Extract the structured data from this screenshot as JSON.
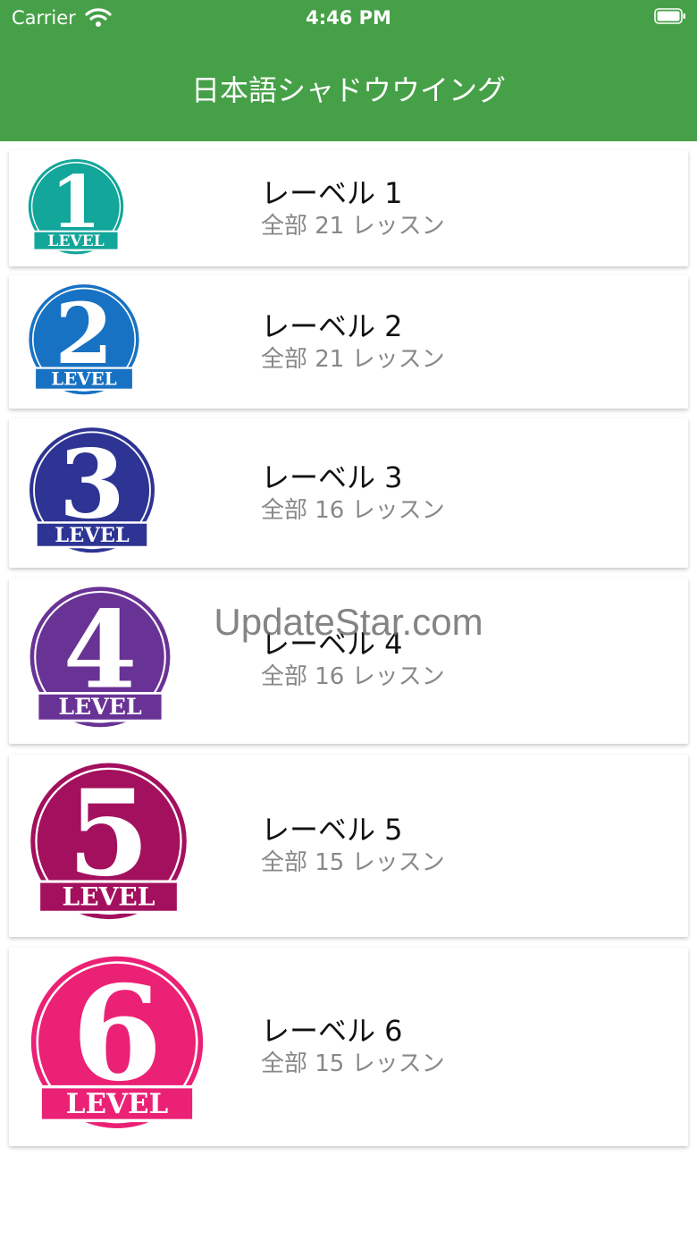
{
  "status_bar": {
    "carrier": "Carrier",
    "time": "4:46 PM",
    "wifi_icon": "wifi-icon",
    "battery_icon": "battery-icon"
  },
  "nav": {
    "title": "日本語シャドウウイング"
  },
  "badge_text": "LEVEL",
  "levels": [
    {
      "title": "レーベル 1",
      "subtitle": "全部 21 レッスン",
      "number": "1",
      "color": "#13a69a"
    },
    {
      "title": "レーベル 2",
      "subtitle": "全部 21 レッスン",
      "number": "2",
      "color": "#1872c3"
    },
    {
      "title": "レーベル 3",
      "subtitle": "全部 16 レッスン",
      "number": "3",
      "color": "#2e3493"
    },
    {
      "title": "レーベル 4",
      "subtitle": "全部 16 レッスン",
      "number": "4",
      "color": "#693396"
    },
    {
      "title": "レーベル 5",
      "subtitle": "全部 15 レッスン",
      "number": "5",
      "color": "#a3105e"
    },
    {
      "title": "レーベル 6",
      "subtitle": "全部 15 レッスン",
      "number": "6",
      "color": "#eb2175"
    }
  ],
  "watermark": "UpdateStar.com"
}
